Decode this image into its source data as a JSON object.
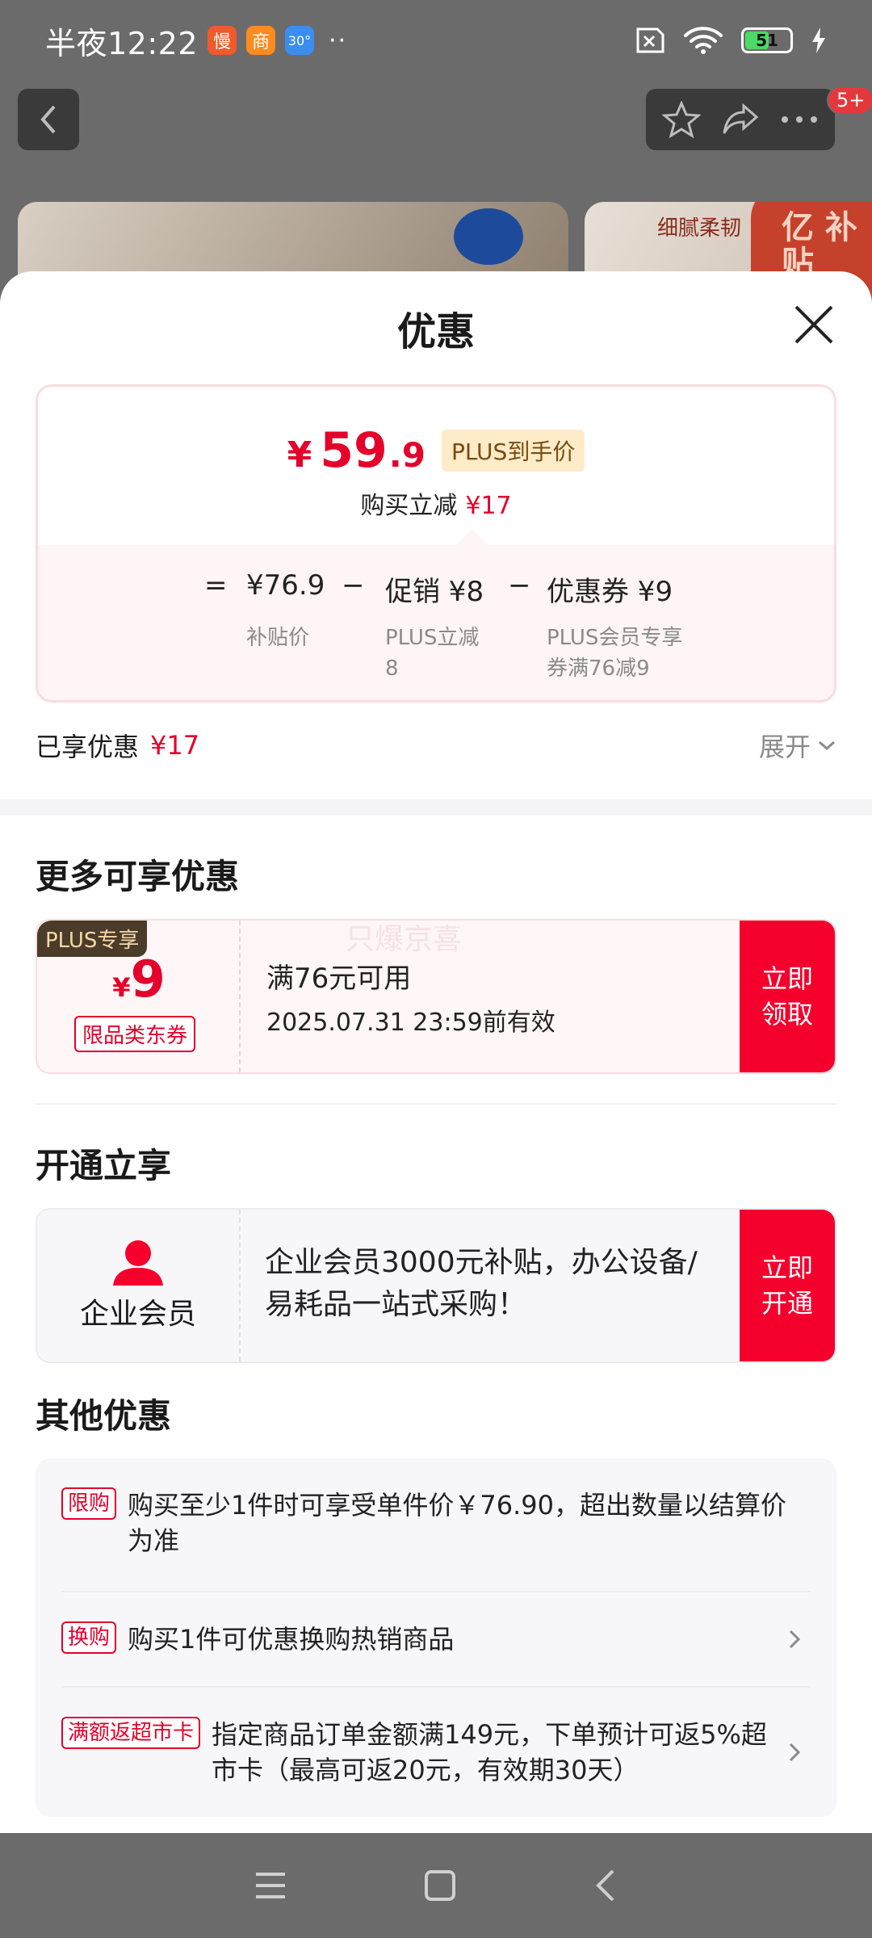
{
  "status_bar": {
    "time": "半夜12:22",
    "apps": [
      {
        "icon": "app-icon-1",
        "text": "慢",
        "color": "#f25a2b"
      },
      {
        "icon": "app-icon-2",
        "text": "商",
        "color": "#ff8a1f"
      },
      {
        "icon": "weather-icon",
        "text": "30°",
        "color": "#3b8df0"
      }
    ],
    "dots": "··",
    "battery": "51"
  },
  "background": {
    "badge": "5+",
    "banner_tag": "细腻柔韧",
    "banner_yi": "亿 补贴"
  },
  "sheet": {
    "title": "优惠",
    "price": {
      "yen": "¥",
      "integer": "59",
      "decimal": ".9",
      "plus_tag": "PLUS到手价"
    },
    "reduce": {
      "label": "购买立减",
      "amount": "¥17"
    },
    "formula": {
      "eq": "=",
      "base": "¥76.9",
      "minus1": "−",
      "promo": "促销 ¥8",
      "minus2": "−",
      "coupon": "优惠券 ¥9",
      "base_label": "补贴价",
      "promo_label": "PLUS立减 8",
      "coupon_label": "PLUS会员专享券满76减9"
    },
    "enjoyed": {
      "label": "已享优惠",
      "amount": "¥17",
      "expand": "展开"
    }
  },
  "more": {
    "title": "更多可享优惠",
    "coupon": {
      "plus_only": "PLUS专享",
      "yen": "¥",
      "value": "9",
      "category": "限品类东券",
      "condition": "满76元可用",
      "expiry": "2025.07.31 23:59前有效",
      "watermark": "只爆京喜",
      "button": "立即 领取"
    }
  },
  "open": {
    "title": "开通立享",
    "member_label": "企业会员",
    "member_desc": "企业会员3000元补贴，办公设备/易耗品一站式采购！",
    "button": "立即 开通"
  },
  "others": {
    "title": "其他优惠",
    "items": [
      {
        "tag": "限购",
        "text": "购买至少1件时可享受单件价￥76.90，超出数量以结算价为准"
      },
      {
        "tag": "换购",
        "text": "购买1件可优惠换购热销商品"
      },
      {
        "tag": "满额返超市卡",
        "text": "指定商品订单金额满149元，下单预计可返5%超市卡（最高可返20元，有效期30天）"
      }
    ]
  },
  "colors": {
    "accent": "#e4002b",
    "button_red": "#f5002d",
    "plus_gold": "#fdecc7"
  }
}
